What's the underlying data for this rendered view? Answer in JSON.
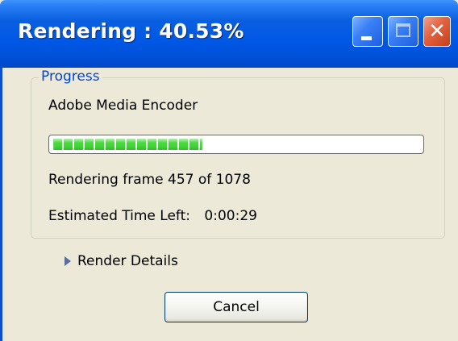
{
  "window": {
    "title": "Rendering : 40.53%"
  },
  "progress_group": {
    "label": "Progress",
    "app_name": "Adobe Media Encoder",
    "progress_percent": 40.53,
    "frame_text": "Rendering frame 457 of 1078",
    "time_left_label": "Estimated Time Left:",
    "time_left_value": "0:00:29"
  },
  "details": {
    "label": "Render Details"
  },
  "buttons": {
    "cancel_label": "Cancel"
  },
  "colors": {
    "titlebar_blue": "#0058e6",
    "group_label_blue": "#0046d5",
    "progress_green": "#46d83a",
    "dialog_bg": "#ece9d8"
  }
}
